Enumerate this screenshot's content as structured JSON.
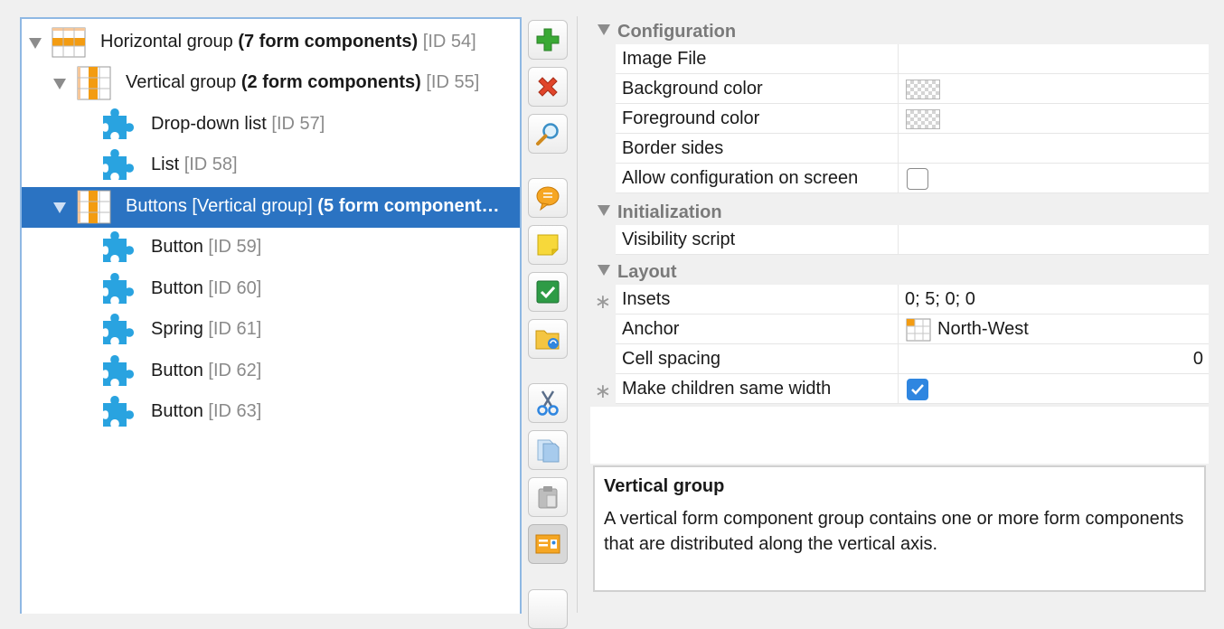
{
  "tree": {
    "items": [
      {
        "label": "Horizontal group",
        "bold": "(7 form components)",
        "id": "[ID 54]",
        "icon": "horizontal-group-icon",
        "expanded": true,
        "level": 0
      },
      {
        "label": "Vertical group",
        "bold": "(2 form components)",
        "id": "[ID 55]",
        "icon": "vertical-group-icon",
        "expanded": true,
        "level": 1
      },
      {
        "label": "Drop-down list",
        "bold": "",
        "id": "[ID 57]",
        "icon": "puzzle-piece-icon",
        "level": 2
      },
      {
        "label": "List",
        "bold": "",
        "id": "[ID 58]",
        "icon": "puzzle-piece-icon",
        "level": 2
      },
      {
        "label": "Buttons [Vertical group]",
        "bold": "(5 form component…",
        "id": "",
        "icon": "vertical-group-icon",
        "expanded": true,
        "selected": true,
        "level": 1
      },
      {
        "label": "Button",
        "bold": "",
        "id": "[ID 59]",
        "icon": "puzzle-piece-icon",
        "level": 2
      },
      {
        "label": "Button",
        "bold": "",
        "id": "[ID 60]",
        "icon": "puzzle-piece-icon",
        "level": 2
      },
      {
        "label": "Spring",
        "bold": "",
        "id": "[ID 61]",
        "icon": "puzzle-piece-icon",
        "level": 2
      },
      {
        "label": "Button",
        "bold": "",
        "id": "[ID 62]",
        "icon": "puzzle-piece-icon",
        "level": 2
      },
      {
        "label": "Button",
        "bold": "",
        "id": "[ID 63]",
        "icon": "puzzle-piece-icon",
        "level": 2
      }
    ]
  },
  "toolbar": {
    "buttons": [
      "add-icon",
      "delete-icon",
      "search-icon",
      "comment-icon",
      "note-icon",
      "check-icon",
      "folder-sync-icon",
      "cut-icon",
      "copy-icon",
      "paste-icon",
      "form-view-icon"
    ]
  },
  "properties": {
    "sections": [
      {
        "title": "Configuration",
        "rows": [
          {
            "name": "Image File",
            "value": ""
          },
          {
            "name": "Background color",
            "value": ""
          },
          {
            "name": "Foreground color",
            "value": ""
          },
          {
            "name": "Border sides",
            "value": ""
          },
          {
            "name": "Allow configuration on screen",
            "value": ""
          }
        ]
      },
      {
        "title": "Initialization",
        "rows": [
          {
            "name": "Visibility script",
            "value": ""
          }
        ]
      },
      {
        "title": "Layout",
        "rows": [
          {
            "name": "Insets",
            "value": "0; 5; 0; 0",
            "required": true
          },
          {
            "name": "Anchor",
            "value": "North-West"
          },
          {
            "name": "Cell spacing",
            "value": "0"
          },
          {
            "name": "Make children same width",
            "value": "",
            "required": true,
            "checked": true
          }
        ]
      }
    ],
    "required_marker": "∗"
  },
  "description": {
    "title": "Vertical group",
    "text": "A vertical form component group contains one or more form components that are distributed along the vertical axis."
  },
  "colors": {
    "selection": "#2b73c2",
    "accent_orange": "#f39c12",
    "puzzle_blue": "#29a3e0",
    "checkbox_blue": "#2f86e0"
  }
}
